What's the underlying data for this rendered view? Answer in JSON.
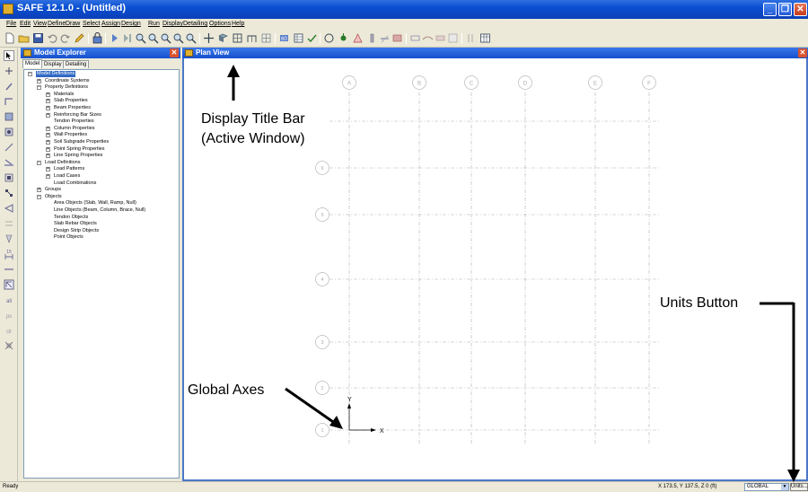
{
  "window": {
    "title": "SAFE 12.1.0 - (Untitled)"
  },
  "menu": [
    "File",
    "Edit",
    "View",
    "Define",
    "Draw",
    "Select",
    "Assign",
    "Design",
    "Run",
    "Display",
    "Detailing",
    "Options",
    "Help"
  ],
  "explorer": {
    "title": "Model Explorer",
    "tabs": [
      "Model",
      "Display",
      "Detailing"
    ],
    "tree": [
      {
        "label": "Model Definitions",
        "level": 0,
        "expander": "−",
        "selected": true
      },
      {
        "label": "Coordinate Systems",
        "level": 1,
        "expander": "+"
      },
      {
        "label": "Property Definitions",
        "level": 1,
        "expander": "−"
      },
      {
        "label": "Materials",
        "level": 2,
        "expander": "+"
      },
      {
        "label": "Slab Properties",
        "level": 2,
        "expander": "+"
      },
      {
        "label": "Beam Properties",
        "level": 2,
        "expander": "+"
      },
      {
        "label": "Reinforcing Bar Sizes",
        "level": 2,
        "expander": "+"
      },
      {
        "label": "Tendon Properties",
        "level": 2,
        "expander": ""
      },
      {
        "label": "Column Properties",
        "level": 2,
        "expander": "+"
      },
      {
        "label": "Wall Properties",
        "level": 2,
        "expander": "+"
      },
      {
        "label": "Soil Subgrade Properties",
        "level": 2,
        "expander": "+"
      },
      {
        "label": "Point Spring Properties",
        "level": 2,
        "expander": "+"
      },
      {
        "label": "Line Spring Properties",
        "level": 2,
        "expander": "+"
      },
      {
        "label": "Load Definitions",
        "level": 1,
        "expander": "−"
      },
      {
        "label": "Load Patterns",
        "level": 2,
        "expander": "+"
      },
      {
        "label": "Load Cases",
        "level": 2,
        "expander": "+"
      },
      {
        "label": "Load Combinations",
        "level": 2,
        "expander": ""
      },
      {
        "label": "Groups",
        "level": 1,
        "expander": "+"
      },
      {
        "label": "Objects",
        "level": 1,
        "expander": "−"
      },
      {
        "label": "Area Objects (Slab, Wall, Ramp, Null)",
        "level": 2,
        "expander": ""
      },
      {
        "label": "Line Objects (Beam, Column, Brace, Null)",
        "level": 2,
        "expander": ""
      },
      {
        "label": "Tendon Objects",
        "level": 2,
        "expander": ""
      },
      {
        "label": "Slab Rebar Objects",
        "level": 2,
        "expander": ""
      },
      {
        "label": "Design Strip Objects",
        "level": 2,
        "expander": ""
      },
      {
        "label": "Point Objects",
        "level": 2,
        "expander": ""
      }
    ]
  },
  "planview": {
    "title": "Plan View",
    "grid_x_labels": [
      "A",
      "B",
      "C",
      "D",
      "E",
      "F"
    ],
    "grid_y_labels": [
      "6",
      "5",
      "4",
      "3",
      "2",
      "1"
    ],
    "axis_x_label": "X",
    "axis_y_label": "Y"
  },
  "status": {
    "text": "Ready",
    "coordinates": "X 173.5, Y 137.5, Z 0 (ft)",
    "coord_system": "GLOBAL",
    "units_label": "Units..."
  },
  "annotations": {
    "title_bar_line1": "Display Title Bar",
    "title_bar_line2": "(Active Window)",
    "units_button": "Units Button",
    "global_axes": "Global Axes"
  }
}
